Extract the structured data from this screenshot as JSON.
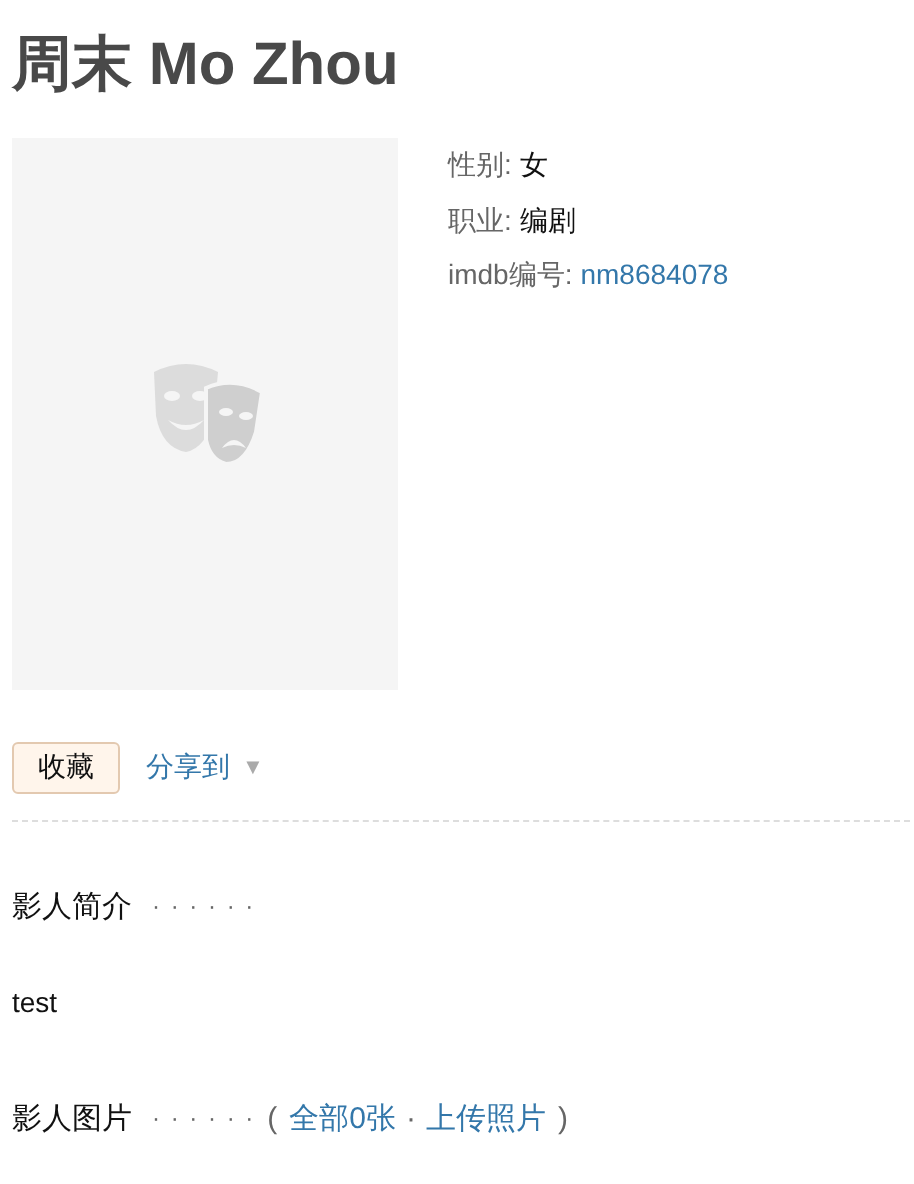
{
  "title": "周末 Mo Zhou",
  "photo": {
    "kind": "placeholder"
  },
  "info": [
    {
      "label": "性别:",
      "value": "女",
      "kind": "text"
    },
    {
      "label": "职业:",
      "value": "编剧",
      "kind": "text"
    },
    {
      "label": "imdb编号:",
      "value": "nm8684078",
      "kind": "link"
    }
  ],
  "actions": {
    "collect_button": "收藏",
    "share_link": "分享到",
    "share_caret": "▼"
  },
  "sections": [
    {
      "heading": "影人简介",
      "dots": "· · · · · ·",
      "body": "test"
    },
    {
      "heading": "影人图片",
      "dots": "· · · · · ·",
      "open_paren": "(",
      "links": [
        "全部0张",
        "上传照片"
      ],
      "separator": "·",
      "close_paren": ")"
    }
  ]
}
